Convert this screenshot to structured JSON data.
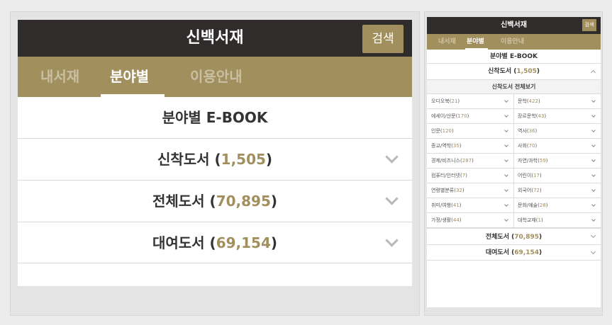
{
  "title": "신백서재",
  "search_label": "검색",
  "tabs": [
    {
      "label": "내서재",
      "active": false
    },
    {
      "label": "분야별",
      "active": true
    },
    {
      "label": "이용안내",
      "active": false
    }
  ],
  "section_title": "분야별 E-BOOK",
  "rows": [
    {
      "name": "신착도서",
      "count": "1,505"
    },
    {
      "name": "전체도서",
      "count": "70,895"
    },
    {
      "name": "대여도서",
      "count": "69,154"
    }
  ],
  "view_all_label": "신착도서 전체보기",
  "categories": [
    {
      "name": "오디오북",
      "count": "21"
    },
    {
      "name": "문학",
      "count": "422"
    },
    {
      "name": "에세이/산문",
      "count": "170"
    },
    {
      "name": "장르문학",
      "count": "43"
    },
    {
      "name": "인문",
      "count": "120"
    },
    {
      "name": "역사",
      "count": "36"
    },
    {
      "name": "종교/역학",
      "count": "35"
    },
    {
      "name": "사회",
      "count": "70"
    },
    {
      "name": "경제/비즈니스",
      "count": "287"
    },
    {
      "name": "자연/과학",
      "count": "59"
    },
    {
      "name": "컴퓨터/인터넷",
      "count": "7"
    },
    {
      "name": "어린이",
      "count": "17"
    },
    {
      "name": "연령별분류",
      "count": "32"
    },
    {
      "name": "외국어",
      "count": "72"
    },
    {
      "name": "취미/여행",
      "count": "41"
    },
    {
      "name": "문화/예술",
      "count": "28"
    },
    {
      "name": "가정/생활",
      "count": "44"
    },
    {
      "name": "대학교재",
      "count": "1"
    }
  ],
  "colors": {
    "header": "#2f2c2b",
    "accent": "#a28f5e"
  }
}
